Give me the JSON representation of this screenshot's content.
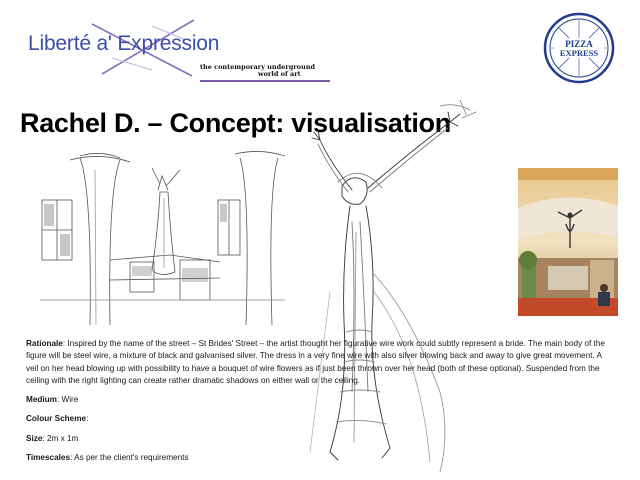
{
  "header": {
    "logo_text": "Liberté a' Expression",
    "tagline_line1": "the contemporary underground",
    "tagline_line2": "world of art",
    "brand_logo_top": "PIZZA",
    "brand_logo_bottom": "EXPRESS"
  },
  "title": "Rachel D. – Concept: visualisation",
  "description": {
    "rationale_label": "Rationale",
    "rationale_text": ": Inspired by the name of the street – St Brides' Street – the artist thought her figurative wire work could subtly represent a bride. The main body of the figure will be steel wire, a mixture of black and galvanised silver. The dress in a very fine wire with also silver blowing back and away to give great movement. A veil on her head blowing up with possibility to have a bouquet of wire flowers as if just been thrown over her head (both of these optional). Suspended from the ceiling with the right lighting can create rather dramatic  shadows on either wall or the ceiling.",
    "medium_label": "Medium",
    "medium_value": ": Wire",
    "colour_label": "Colour Scheme",
    "colour_value": ":",
    "size_label": "Size",
    "size_value": ": 2m x 1m",
    "timescales_label": "Timescales",
    "timescales_value": ": As per the client's requirements"
  },
  "colors": {
    "logo_blue": "#3a4fa8",
    "logo_purple": "#7a5aa8",
    "pizza_blue": "#1f3d8f",
    "text": "#1a1a1a"
  }
}
